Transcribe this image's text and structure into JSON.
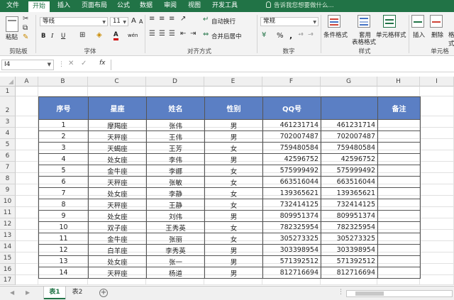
{
  "ribbon_tabs": [
    "文件",
    "开始",
    "插入",
    "页面布局",
    "公式",
    "数据",
    "审阅",
    "视图",
    "开发工具"
  ],
  "active_tab": "开始",
  "tell_me": "告诉我您想要做什么...",
  "clipboard": {
    "paste": "粘贴",
    "label": "剪贴板"
  },
  "font": {
    "name": "等线",
    "size": "11",
    "label": "字体",
    "bold": "B",
    "italic": "I",
    "underline": "U",
    "grow": "A",
    "shrink": "A",
    "color_letter": "A",
    "phonetic": "wén"
  },
  "alignment": {
    "wrap": "自动换行",
    "merge": "合并后居中",
    "label": "对齐方式"
  },
  "number": {
    "format": "常规",
    "label": "数字",
    "percent": "%",
    "comma": ","
  },
  "styles": {
    "conditional": "条件格式",
    "table_line1": "套用",
    "table_line2": "表格格式",
    "cell_styles": "单元格样式",
    "label": "样式"
  },
  "cells": {
    "insert": "插入",
    "delete": "删除",
    "format": "格式",
    "label": "单元格"
  },
  "formula_bar": {
    "name_box": "I4",
    "fx": "fx",
    "value": ""
  },
  "columns": [
    "A",
    "B",
    "C",
    "D",
    "E",
    "F",
    "G",
    "H",
    "I"
  ],
  "rows": [
    "1",
    "2",
    "3",
    "4",
    "5",
    "6",
    "7",
    "8",
    "9",
    "10",
    "11",
    "12",
    "13",
    "14",
    "15",
    "16",
    "17"
  ],
  "table": {
    "headers": [
      "序号",
      "星座",
      "姓名",
      "性别",
      "QQ号",
      "",
      "备注"
    ],
    "rows": [
      [
        "1",
        "摩羯座",
        "张伟",
        "男",
        "461231714",
        "461231714",
        ""
      ],
      [
        "2",
        "天秤座",
        "王伟",
        "男",
        "702007487",
        "702007487",
        ""
      ],
      [
        "3",
        "天蝎座",
        "王芳",
        "女",
        "759480584",
        "759480584",
        ""
      ],
      [
        "4",
        "处女座",
        "李伟",
        "男",
        "42596752",
        "42596752",
        ""
      ],
      [
        "5",
        "金牛座",
        "李娜",
        "女",
        "575999492",
        "575999492",
        ""
      ],
      [
        "6",
        "天秤座",
        "张敏",
        "女",
        "663516044",
        "663516044",
        ""
      ],
      [
        "7",
        "处女座",
        "李静",
        "女",
        "139365621",
        "139365621",
        ""
      ],
      [
        "8",
        "天秤座",
        "王静",
        "女",
        "732414125",
        "732414125",
        ""
      ],
      [
        "9",
        "处女座",
        "刘伟",
        "男",
        "809951374",
        "809951374",
        ""
      ],
      [
        "10",
        "双子座",
        "王秀英",
        "女",
        "782325954",
        "782325954",
        ""
      ],
      [
        "11",
        "金牛座",
        "张丽",
        "女",
        "305273325",
        "305273325",
        ""
      ],
      [
        "12",
        "白羊座",
        "李秀英",
        "男",
        "303398954",
        "303398954",
        ""
      ],
      [
        "13",
        "处女座",
        "张一",
        "男",
        "571392512",
        "571392512",
        ""
      ],
      [
        "14",
        "天秤座",
        "杨道",
        "男",
        "812716694",
        "812716694",
        ""
      ]
    ]
  },
  "sheets": [
    "表1",
    "表2"
  ],
  "active_sheet": "表1",
  "colors": {
    "excel_green": "#217346",
    "header_blue": "#5b7fc4"
  }
}
